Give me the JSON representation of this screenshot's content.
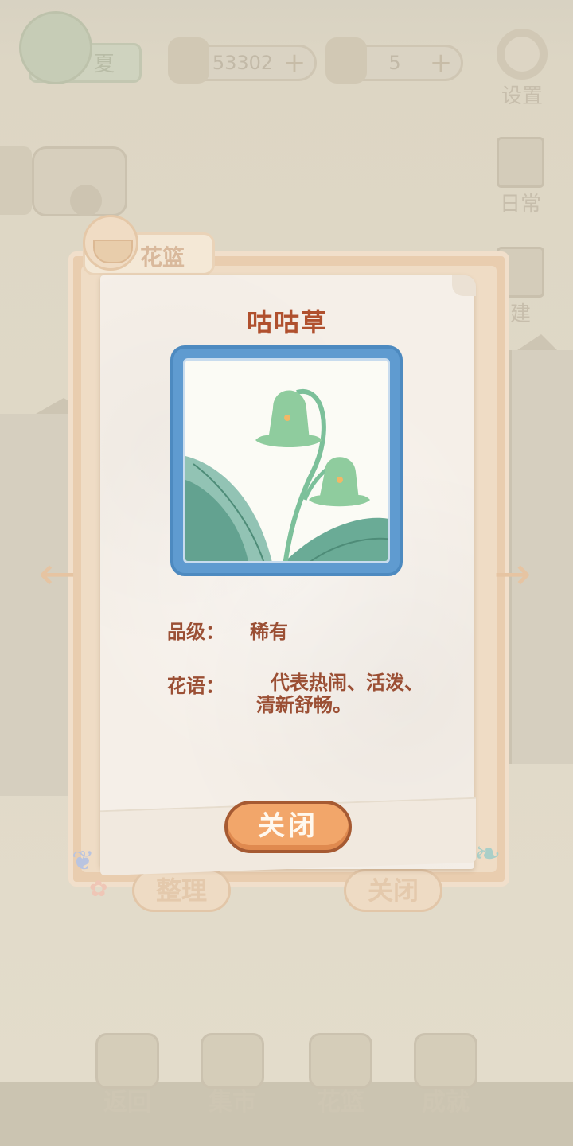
{
  "hud": {
    "season_label": "夏",
    "fish_count": "53302",
    "cheese_count": "5",
    "plus_label": "+",
    "settings_label": "设置",
    "daily_label": "日常",
    "build_label": "建"
  },
  "bottom_nav": {
    "back": "返回",
    "market": "集市",
    "basket": "花篮",
    "achievements": "成就"
  },
  "panel": {
    "tab_title": "花篮",
    "sort_label": "整理",
    "close_label": "关闭"
  },
  "card": {
    "flower_name": "咕咕草",
    "grade_label": "品级：",
    "grade_value": "稀有",
    "language_label": "花语：",
    "language_value": "代表热闹、活泼、清新舒畅。",
    "close_label": "关闭"
  },
  "colors": {
    "title": "#b0502e",
    "frame": "#5f9bd0",
    "close_button": "#f2a66a"
  }
}
